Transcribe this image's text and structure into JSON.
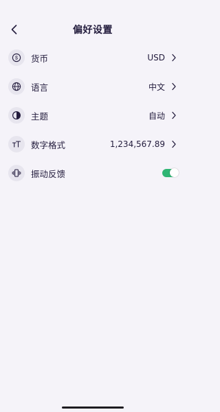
{
  "header": {
    "title": "偏好设置",
    "back_icon": "chevron-left-icon"
  },
  "settings": {
    "currency": {
      "icon": "dollar-coin-icon",
      "label": "货币",
      "value": "USD"
    },
    "language": {
      "icon": "globe-icon",
      "label": "语言",
      "value": "中文"
    },
    "theme": {
      "icon": "half-circle-contrast-icon",
      "label": "主题",
      "value": "自动"
    },
    "number_format": {
      "icon": "text-size-icon",
      "label": "数字格式",
      "value": "1,234,567.89"
    },
    "haptics": {
      "icon": "vibration-icon",
      "label": "振动反馈",
      "enabled": true
    }
  },
  "colors": {
    "background": "#f5f3f9",
    "text": "#231c3d",
    "icon_bg": "#e7e5ee",
    "toggle_on": "#2fb574"
  }
}
